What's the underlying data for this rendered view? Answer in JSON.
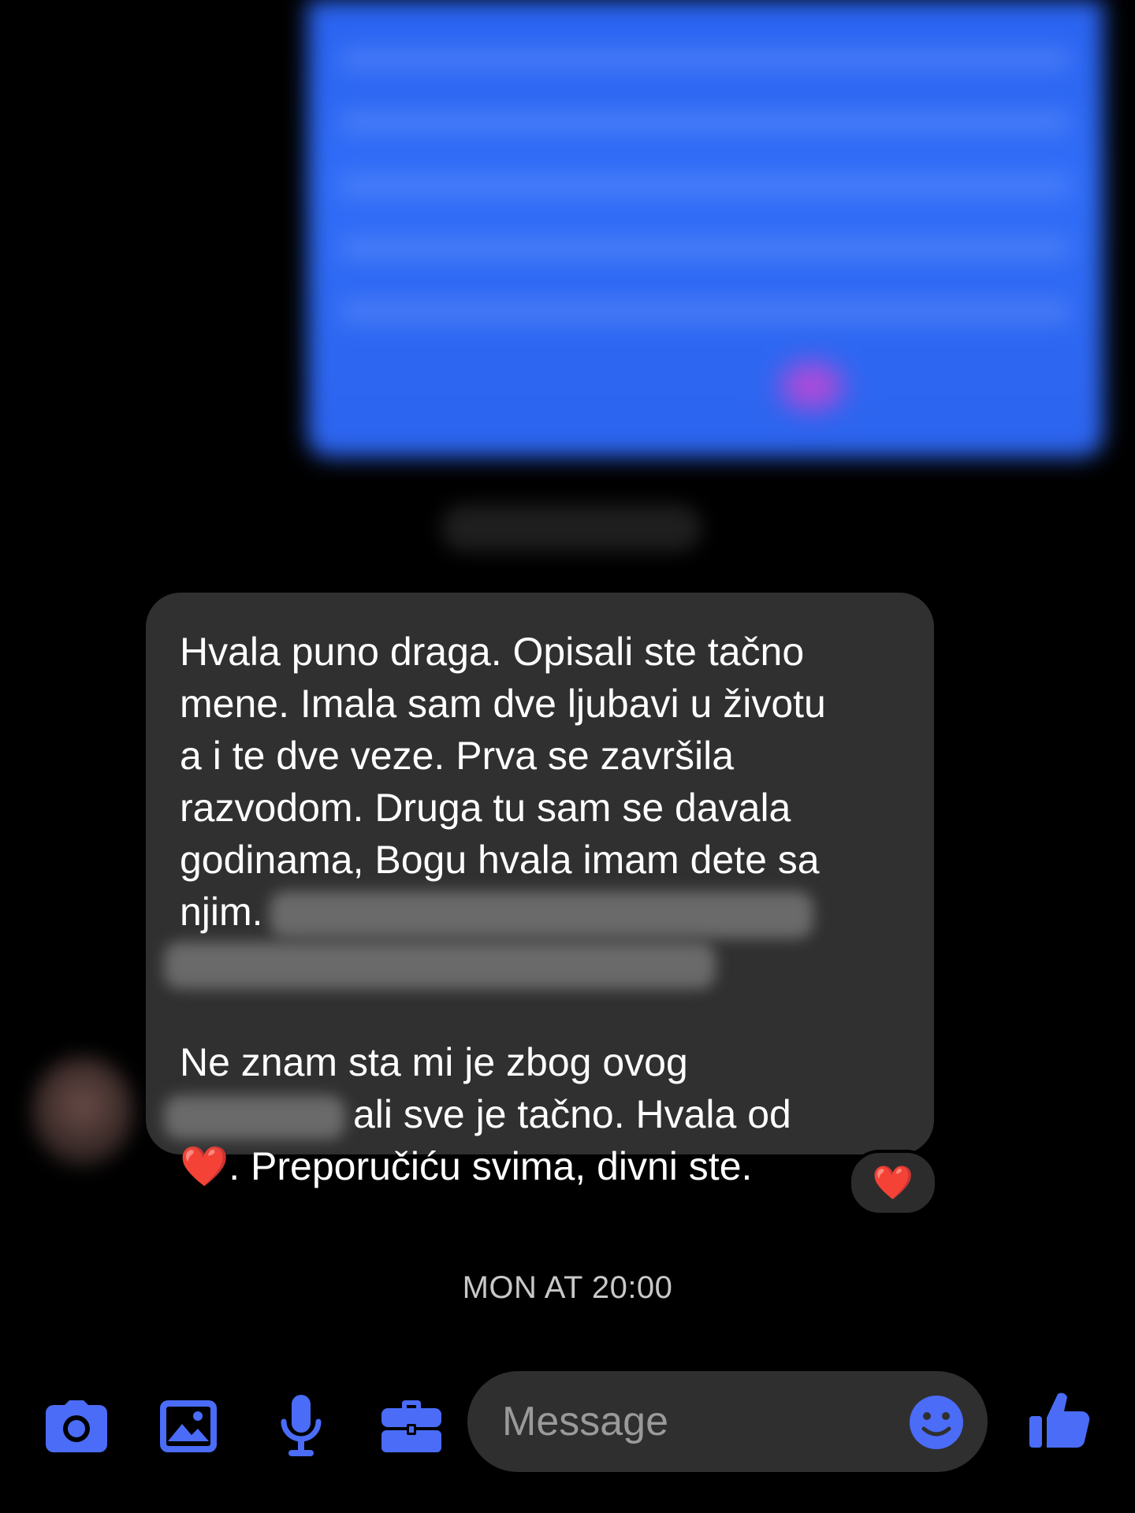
{
  "thread": {
    "incoming_message": {
      "lines_part1": [
        "Hvala puno draga. Opisali ste tačno",
        "mene. Imala sam dve ljubavi u životu",
        "a i te dve veze. Prva se završila",
        "razvodom. Druga tu sam se davala",
        "godinama, Bogu hvala imam dete sa"
      ],
      "line6_text": "njim.",
      "line7_text": "Ne znam sta mi je zbog ovog",
      "line8_text": "ali sve je tačno. Hvala od",
      "line9_heart": "❤️",
      "line9_text": ". Preporučiću svima, divni ste."
    },
    "reaction": "❤️",
    "timestamp": "MON AT 20:00"
  },
  "composer": {
    "placeholder": "Message",
    "icons": [
      "camera-icon",
      "gallery-icon",
      "microphone-icon",
      "briefcase-icon",
      "emoji-icon",
      "thumbs-up-icon"
    ]
  },
  "colors": {
    "accent": "#4a6cf7",
    "bubble_incoming": "#303030",
    "outgoing_bubble": "#2f6cf7",
    "background": "#000000",
    "timestamp": "#c8c8c8",
    "heart": "#e8202a"
  }
}
